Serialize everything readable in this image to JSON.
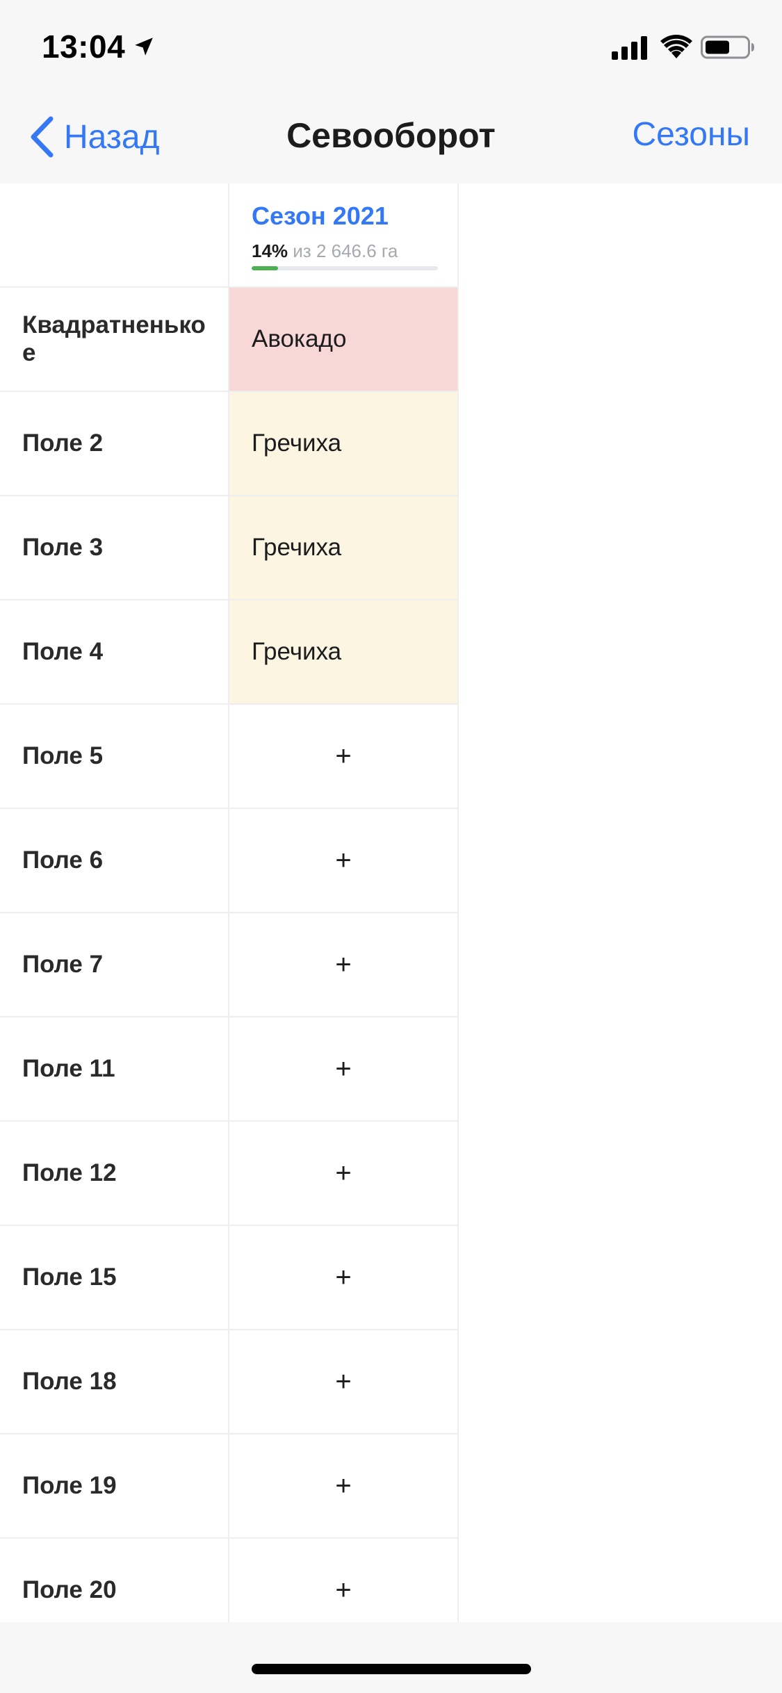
{
  "status_bar": {
    "time": "13:04",
    "icons": [
      "location-arrow-icon",
      "cellular-signal-icon",
      "wifi-icon",
      "battery-icon"
    ]
  },
  "nav": {
    "back_label": "Назад",
    "title": "Севооборот",
    "seasons_label": "Сезоны"
  },
  "season": {
    "title": "Сезон 2021",
    "percent": "14%",
    "total": "из 2 646.6 га",
    "progress": 0.14
  },
  "colors": {
    "accent": "#3478f6",
    "progress": "#4cb050",
    "avocado_bg": "#f8d8d7",
    "buckwheat_bg": "#fbf5e2"
  },
  "rows": [
    {
      "field": "Квадратненькое",
      "crop": "Авокадо",
      "color": "#f8d8d7"
    },
    {
      "field": "Поле 2",
      "crop": "Гречиха",
      "color": "#fbf5e2"
    },
    {
      "field": "Поле 3",
      "crop": "Гречиха",
      "color": "#fbf5e2"
    },
    {
      "field": "Поле 4",
      "crop": "Гречиха",
      "color": "#fbf5e2"
    },
    {
      "field": "Поле 5",
      "crop": "+",
      "color": ""
    },
    {
      "field": "Поле 6",
      "crop": "+",
      "color": ""
    },
    {
      "field": "Поле 7",
      "crop": "+",
      "color": ""
    },
    {
      "field": "Поле 11",
      "crop": "+",
      "color": ""
    },
    {
      "field": "Поле 12",
      "crop": "+",
      "color": ""
    },
    {
      "field": "Поле 15",
      "crop": "+",
      "color": ""
    },
    {
      "field": "Поле 18",
      "crop": "+",
      "color": ""
    },
    {
      "field": "Поле 19",
      "crop": "+",
      "color": ""
    },
    {
      "field": "Поле 20",
      "crop": "+",
      "color": ""
    }
  ]
}
